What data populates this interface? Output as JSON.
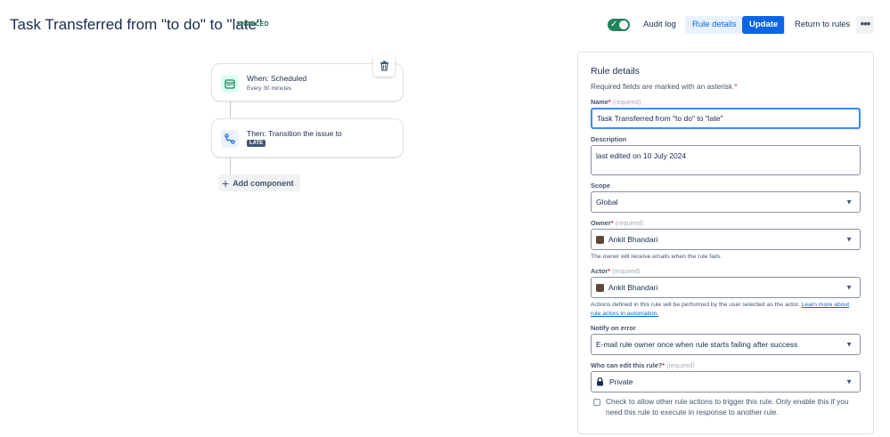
{
  "header": {
    "title": "Task Transferred from \"to do\" to \"late\"",
    "status_badge": "ENABLED",
    "audit_log": "Audit log",
    "rule_details": "Rule details",
    "update": "Update",
    "return_to_rules": "Return to rules",
    "more_icon": "more-icon"
  },
  "flow": {
    "trigger": {
      "title": "When: Scheduled",
      "subtitle": "Every 30 minutes"
    },
    "action": {
      "title": "Then: Transition the issue to",
      "lozenge": "LATE"
    },
    "add_component": "Add component"
  },
  "details": {
    "title": "Rule details",
    "required_note": "Required fields are marked with an asterisk",
    "asterisk": "*",
    "required_hint": "(required)",
    "name_label": "Name",
    "name_value": "Task Transferred from \"to do\" to \"late\"",
    "description_label": "Description",
    "description_value": "last edited on 10 July 2024",
    "scope_label": "Scope",
    "scope_value": "Global",
    "owner_label": "Owner",
    "owner_value": "Ankit Bhandari",
    "owner_help": "The owner will receive emails when the rule fails.",
    "actor_label": "Actor",
    "actor_value": "Ankit Bhandari",
    "actor_help": "Actions defined in this rule will be performed by the user selected as the actor.",
    "actor_help_link": "Learn more about rule actors in automation.",
    "notify_label": "Notify on error",
    "notify_value": "E-mail rule owner once when rule starts failing after success",
    "who_edit_label": "Who can edit this rule?",
    "who_edit_value": "Private",
    "allow_trigger_text": "Check to allow other rule actions to trigger this rule. Only enable this if you need this rule to execute in response to another rule."
  },
  "colors": {
    "primary": "#0c66e4",
    "enabled": "#1f845a",
    "text": "#172b4d"
  }
}
